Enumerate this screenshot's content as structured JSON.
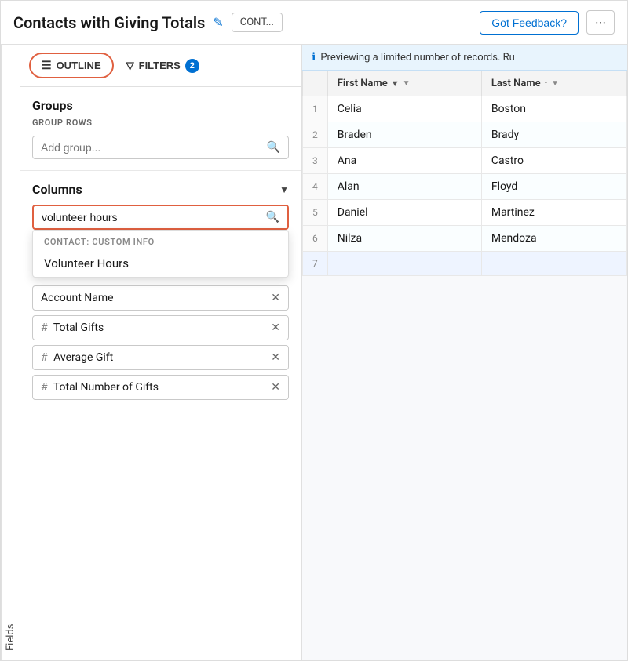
{
  "header": {
    "title": "Contacts with Giving Totals",
    "edit_label": "✎",
    "badge_label": "CONT...",
    "feedback_label": "Got Feedback?",
    "more_label": "⋯"
  },
  "fields_tab": {
    "label": "Fields"
  },
  "toolbar": {
    "outline_label": "OUTLINE",
    "filters_label": "FILTERS",
    "filter_count": "2"
  },
  "groups": {
    "title": "Groups",
    "subtitle": "GROUP ROWS",
    "add_placeholder": "Add group..."
  },
  "columns": {
    "title": "Columns",
    "search_value": "volunteer hours",
    "suggestion_category": "CONTACT: CUSTOM INFO",
    "suggestion_item": "Volunteer Hours",
    "tags": [
      {
        "id": "account-name",
        "label": "Account Name",
        "prefix": ""
      },
      {
        "id": "total-gifts",
        "label": "Total Gifts",
        "prefix": "# "
      },
      {
        "id": "average-gift",
        "label": "Average Gift",
        "prefix": "# "
      },
      {
        "id": "total-number-of-gifts",
        "label": "Total Number of Gifts",
        "prefix": "# "
      }
    ]
  },
  "info_banner": {
    "text": "Previewing a limited number of records. Ru"
  },
  "table": {
    "columns": [
      {
        "id": "row-num",
        "label": ""
      },
      {
        "id": "first-name",
        "label": "First Name",
        "sort": "▼",
        "has_dropdown": true
      },
      {
        "id": "last-name",
        "label": "Last Name",
        "sort": "↑",
        "has_dropdown": true
      }
    ],
    "rows": [
      {
        "num": "1",
        "first": "Celia",
        "last": "Boston"
      },
      {
        "num": "2",
        "first": "Braden",
        "last": "Brady"
      },
      {
        "num": "3",
        "first": "Ana",
        "last": "Castro"
      },
      {
        "num": "4",
        "first": "Alan",
        "last": "Floyd"
      },
      {
        "num": "5",
        "first": "Daniel",
        "last": "Martinez"
      },
      {
        "num": "6",
        "first": "Nilza",
        "last": "Mendoza"
      },
      {
        "num": "7",
        "first": "",
        "last": ""
      }
    ]
  }
}
